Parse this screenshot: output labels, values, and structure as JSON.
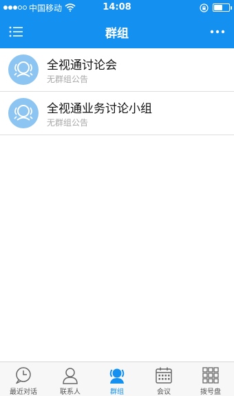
{
  "status_bar": {
    "carrier": "中国移动",
    "time": "14:08",
    "battery_level": 0.55
  },
  "nav": {
    "title": "群组"
  },
  "groups": [
    {
      "name": "全视通讨论会",
      "notice": "无群组公告"
    },
    {
      "name": "全视通业务讨论小组",
      "notice": "无群组公告"
    }
  ],
  "tabs": [
    {
      "label": "最近对话",
      "icon": "chat-clock-icon",
      "active": false
    },
    {
      "label": "联系人",
      "icon": "person-icon",
      "active": false
    },
    {
      "label": "群组",
      "icon": "group-icon",
      "active": true
    },
    {
      "label": "会议",
      "icon": "calendar-icon",
      "active": false
    },
    {
      "label": "拨号盘",
      "icon": "dialpad-icon",
      "active": false
    }
  ],
  "colors": {
    "accent": "#1390f0",
    "avatar": "#8cc4f2"
  }
}
